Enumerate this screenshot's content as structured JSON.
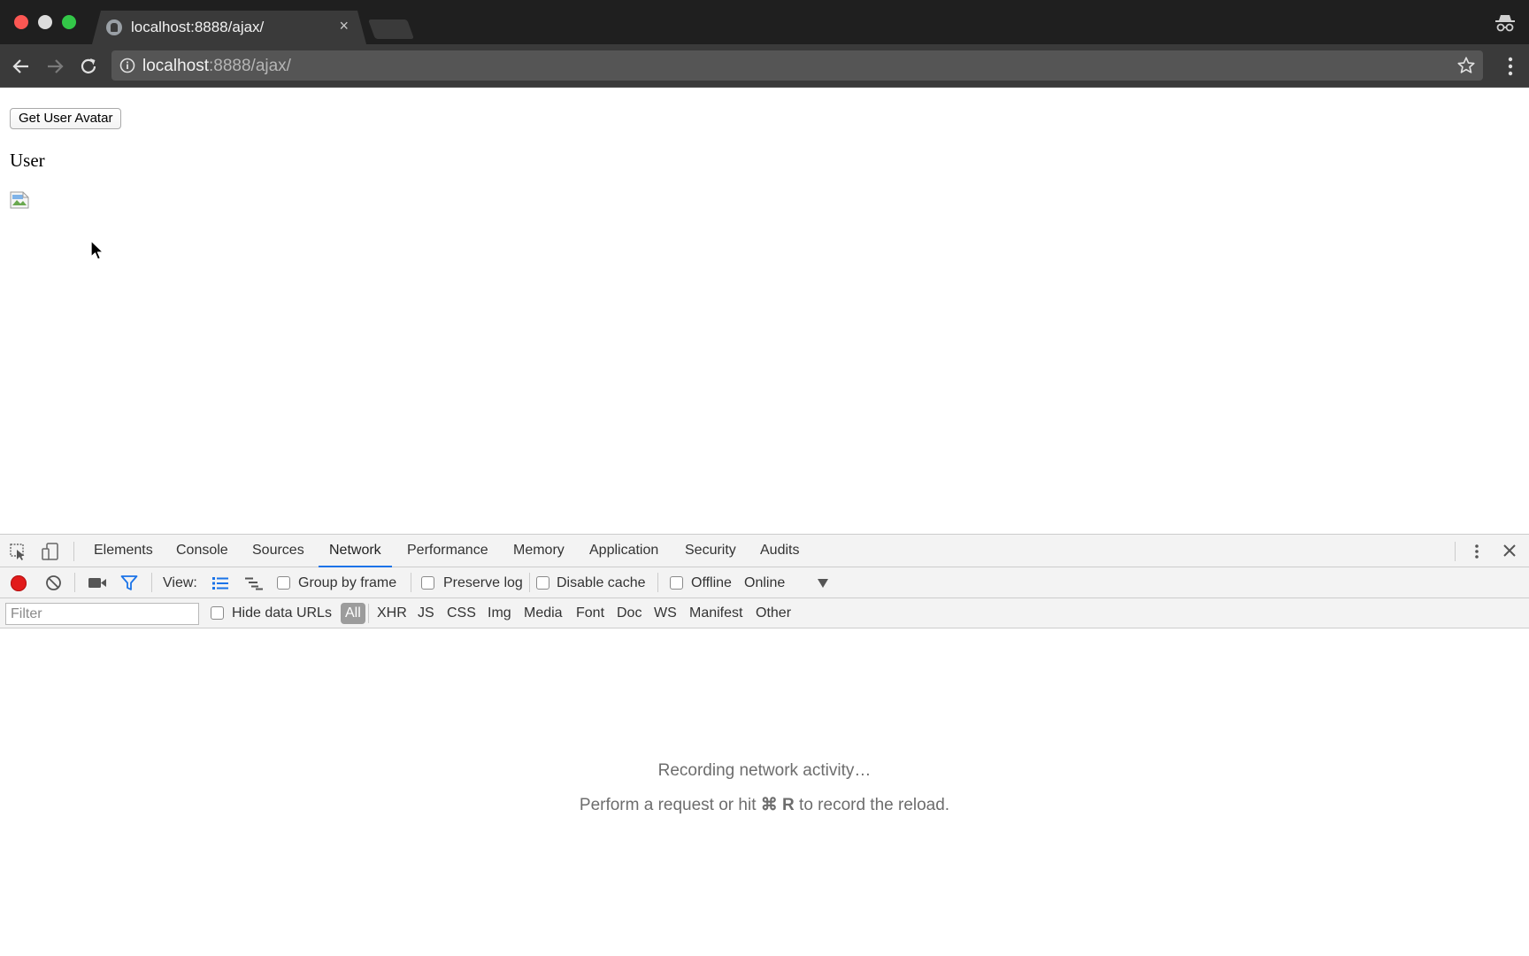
{
  "browser": {
    "tab_title": "localhost:8888/ajax/",
    "tab_close": "×",
    "url_host": "localhost",
    "url_rest": ":8888/ajax/"
  },
  "page": {
    "button_label": "Get User Avatar",
    "heading": "User"
  },
  "devtools": {
    "tabs": [
      "Elements",
      "Console",
      "Sources",
      "Network",
      "Performance",
      "Memory",
      "Application",
      "Security",
      "Audits"
    ],
    "active_tab": "Network",
    "toolbar": {
      "view_label": "View:",
      "group_by_frame": "Group by frame",
      "preserve_log": "Preserve log",
      "disable_cache": "Disable cache",
      "offline": "Offline",
      "throttling": "Online"
    },
    "filter_bar": {
      "filter_placeholder": "Filter",
      "hide_data_urls": "Hide data URLs",
      "types": [
        "All",
        "XHR",
        "JS",
        "CSS",
        "Img",
        "Media",
        "Font",
        "Doc",
        "WS",
        "Manifest",
        "Other"
      ],
      "active_type": "All"
    },
    "empty_state": {
      "line1": "Recording network activity…",
      "line2_prefix": "Perform a request or hit ",
      "line2_shortcut": "⌘ R",
      "line2_suffix": " to record the reload."
    }
  }
}
